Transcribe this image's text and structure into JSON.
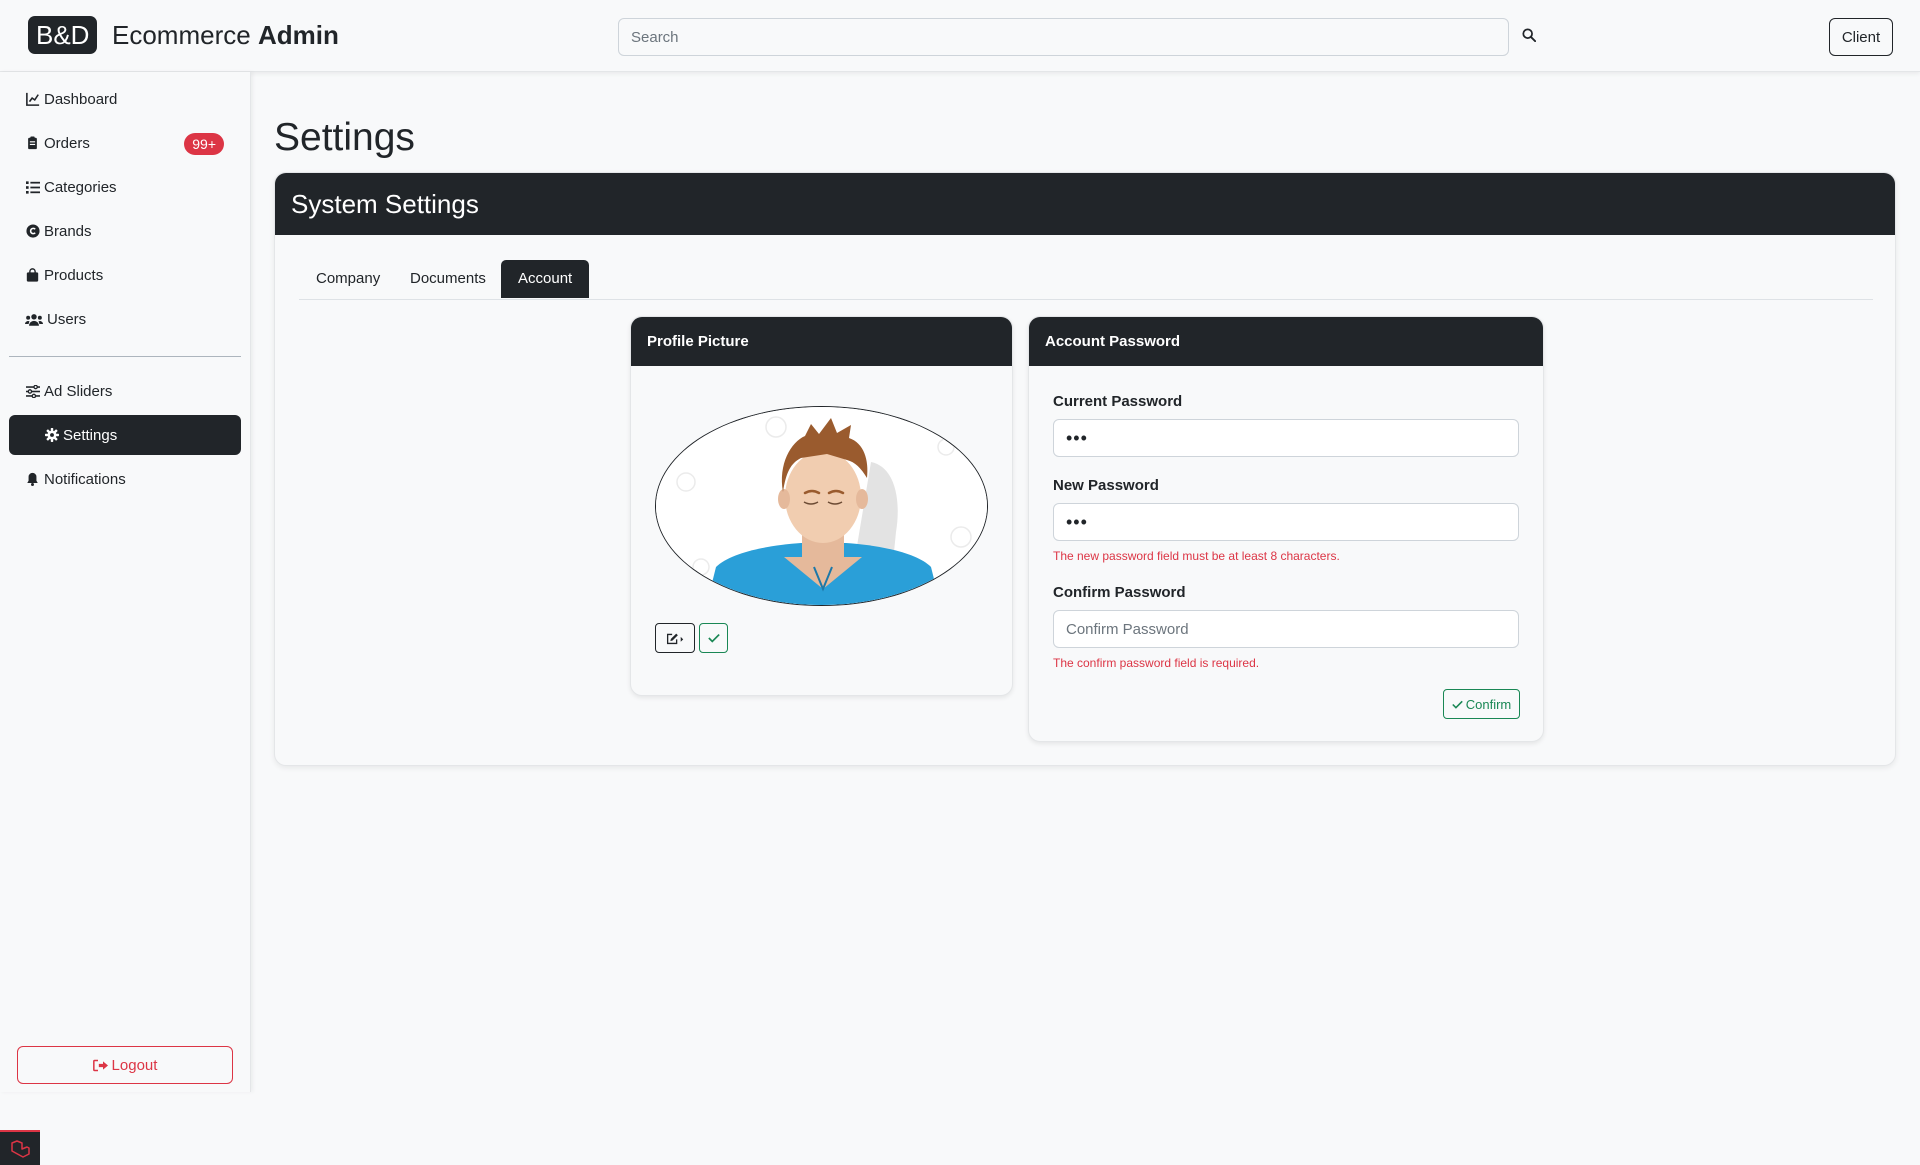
{
  "navbar": {
    "brand_badge": "B&D",
    "brand_name": "Ecommerce",
    "brand_suffix": "Admin",
    "search_placeholder": "Search",
    "client_label": "Client"
  },
  "sidebar": {
    "items": [
      {
        "label": "Dashboard",
        "icon": "chart-line-icon"
      },
      {
        "label": "Orders",
        "icon": "clipboard-icon",
        "badge": "99+"
      },
      {
        "label": "Categories",
        "icon": "list-icon"
      },
      {
        "label": "Brands",
        "icon": "copyright-icon"
      },
      {
        "label": "Products",
        "icon": "shopping-bag-icon"
      },
      {
        "label": "Users",
        "icon": "users-icon"
      },
      {
        "label": "Ad Sliders",
        "icon": "sliders-icon"
      },
      {
        "label": "Settings",
        "icon": "gear-icon",
        "active": true
      },
      {
        "label": "Notifications",
        "icon": "bell-icon"
      }
    ],
    "logout_label": "Logout"
  },
  "page": {
    "title": "Settings",
    "card_title": "System Settings",
    "tabs": [
      {
        "label": "Company"
      },
      {
        "label": "Documents"
      },
      {
        "label": "Account",
        "active": true
      }
    ]
  },
  "profile": {
    "title": "Profile Picture"
  },
  "password": {
    "title": "Account Password",
    "current_label": "Current Password",
    "current_value": "•••",
    "new_label": "New Password",
    "new_value": "•••",
    "new_error": "The new password field must be at least 8 characters.",
    "confirm_label": "Confirm Password",
    "confirm_placeholder": "Confirm Password",
    "confirm_error": "The confirm password field is required.",
    "confirm_button": "Confirm"
  },
  "colors": {
    "dark": "#212529",
    "danger": "#dc3545",
    "success": "#198754",
    "background": "#f8f9fa"
  }
}
